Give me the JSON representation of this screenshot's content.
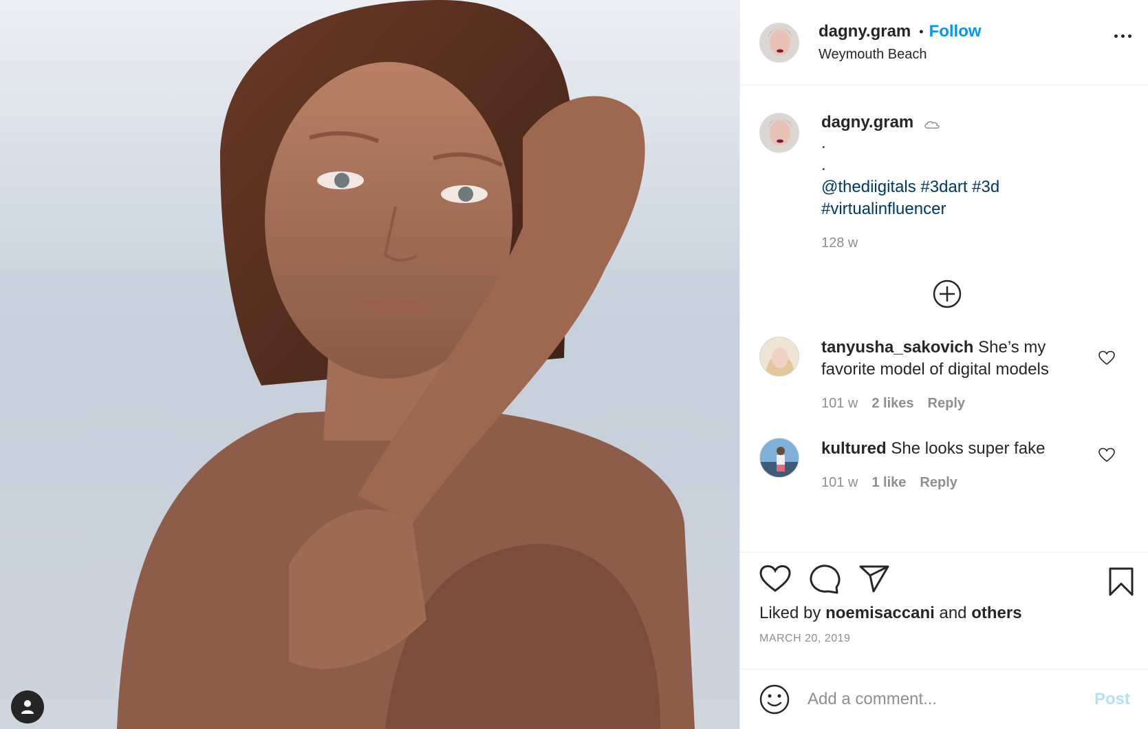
{
  "post": {
    "author": "dagny.gram",
    "follow_label": "Follow",
    "separator": "•",
    "location": "Weymouth Beach",
    "date": "MARCH 20, 2019"
  },
  "caption": {
    "username": "dagny.gram",
    "lines": [
      ".",
      "."
    ],
    "tags": "@thediigitals #3dart #3d #virtualinfluencer",
    "age": "128 w"
  },
  "comments": [
    {
      "username": "tanyusha_sakovich",
      "text": "She’s my favorite model of digital models",
      "age": "101 w",
      "likes": "2 likes",
      "reply": "Reply"
    },
    {
      "username": "kultured",
      "text": "She looks super fake",
      "age": "101 w",
      "likes": "1 like",
      "reply": "Reply"
    }
  ],
  "likes": {
    "prefix": "Liked by",
    "user": "noemisaccani",
    "conj": "and",
    "others": "others"
  },
  "composer": {
    "placeholder": "Add a comment...",
    "post_label": "Post"
  },
  "colors": {
    "link": "#0095f6",
    "hashtag": "#00376b",
    "muted": "#8e8e8e",
    "post_disabled": "#b2dffc"
  },
  "icons": [
    "user-tag-icon",
    "more-options-icon",
    "load-more-icon",
    "heart-icon",
    "comment-icon",
    "share-icon",
    "bookmark-icon",
    "emoji-icon"
  ]
}
